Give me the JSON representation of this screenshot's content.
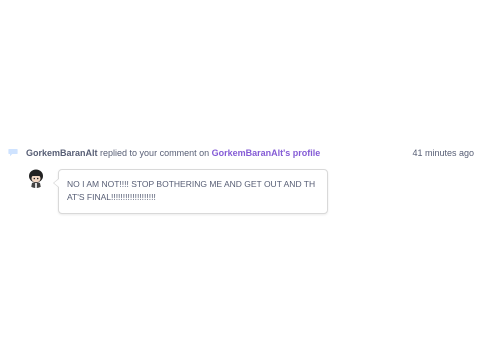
{
  "notification": {
    "icon": "comment-bubble-icon",
    "actor": "GorkemBaranAlt",
    "action_text": " replied to your comment on ",
    "target": "GorkemBaranAlt's profile",
    "timestamp": "41 minutes ago",
    "comment_text": "NO I AM NOT!!!! STOP BOTHERING ME AND GET OUT AND THAT'S FINAL!!!!!!!!!!!!!!!!!!!"
  },
  "colors": {
    "text": "#575e75",
    "link": "#855cd6",
    "icon": "#cfe3ff"
  }
}
